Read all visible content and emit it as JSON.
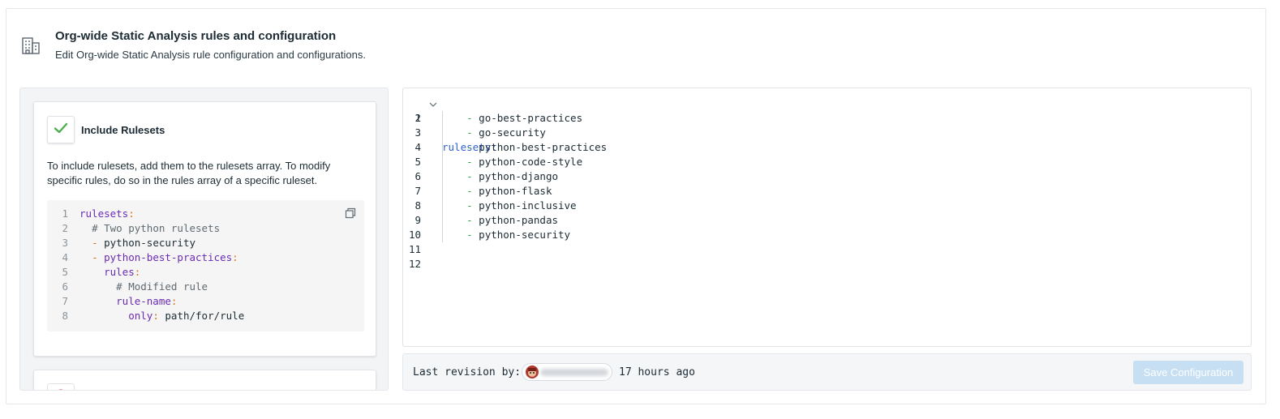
{
  "header": {
    "title": "Org-wide Static Analysis rules and configuration",
    "subtitle": "Edit Org-wide Static Analysis rule configuration and configurations.",
    "icon": "building-icon"
  },
  "include_card": {
    "title": "Include Rulesets",
    "description": "To include rulesets, add them to the rulesets array. To modify specific rules, do so in the rules array of a specific ruleset.",
    "snippet": {
      "line_numbers": [
        "1",
        "2",
        "3",
        "4",
        "5",
        "6",
        "7",
        "8"
      ],
      "lines": [
        {
          "indent": "",
          "key": "rulesets",
          "colon": ":"
        },
        {
          "indent": "  ",
          "comment": "# Two python rulesets"
        },
        {
          "indent": "  ",
          "dash": "- ",
          "value": "python-security"
        },
        {
          "indent": "  ",
          "dash": "- ",
          "key": "python-best-practices",
          "colon": ":"
        },
        {
          "indent": "    ",
          "key": "rules",
          "colon": ":"
        },
        {
          "indent": "      ",
          "comment": "# Modified rule"
        },
        {
          "indent": "      ",
          "key": "rule-name",
          "colon": ":"
        },
        {
          "indent": "        ",
          "key": "only",
          "colon": ": ",
          "value": "path/for/rule"
        }
      ]
    }
  },
  "editor": {
    "line_numbers": [
      "1",
      "2",
      "3",
      "4",
      "5",
      "6",
      "7",
      "8",
      "9",
      "10",
      "11",
      "12"
    ],
    "root_key": "rulesets",
    "root_colon": ":",
    "items": [
      "go-best-practices",
      "go-security",
      "python-best-practices",
      "python-code-style",
      "python-django",
      "python-flask",
      "python-inclusive",
      "python-pandas",
      "python-security"
    ],
    "dash": "-"
  },
  "footer": {
    "last_revision_label": "Last revision by:",
    "time_ago": "17 hours ago",
    "save_label": "Save Configuration"
  },
  "colors": {
    "check_green": "#4caf50",
    "error_red": "#d62f2f",
    "save_button_disabled": "#c6dff3"
  }
}
